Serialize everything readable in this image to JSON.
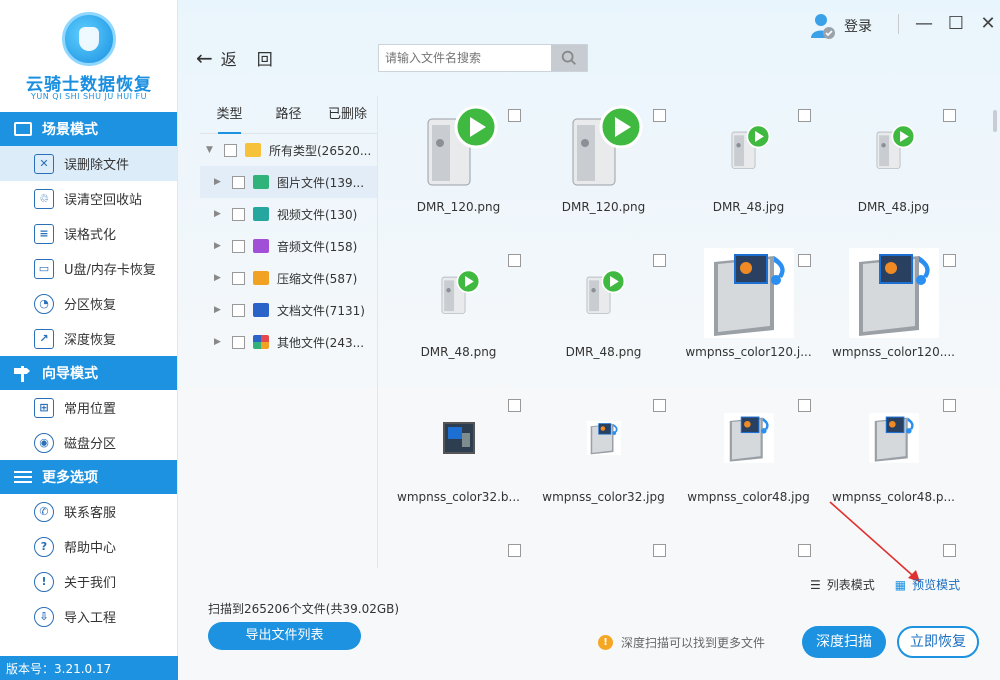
{
  "logo": {
    "title": "云骑士数据恢复",
    "subtitle": "YUN QI SHI SHU JU HUI FU"
  },
  "sidebar": {
    "sections": [
      {
        "title": "场景模式",
        "icon": "scene-icon",
        "items": [
          {
            "label": "误删除文件",
            "icon": "deleted-file-icon",
            "active": true
          },
          {
            "label": "误清空回收站",
            "icon": "recycle-bin-icon"
          },
          {
            "label": "误格式化",
            "icon": "format-icon"
          },
          {
            "label": "U盘/内存卡恢复",
            "icon": "usb-icon"
          },
          {
            "label": "分区恢复",
            "icon": "partition-icon"
          },
          {
            "label": "深度恢复",
            "icon": "deep-recovery-icon"
          }
        ]
      },
      {
        "title": "向导模式",
        "icon": "guide-icon",
        "items": [
          {
            "label": "常用位置",
            "icon": "location-icon"
          },
          {
            "label": "磁盘分区",
            "icon": "disk-icon"
          }
        ]
      },
      {
        "title": "更多选项",
        "icon": "menu-icon",
        "items": [
          {
            "label": "联系客服",
            "icon": "phone-icon"
          },
          {
            "label": "帮助中心",
            "icon": "help-icon"
          },
          {
            "label": "关于我们",
            "icon": "info-icon"
          },
          {
            "label": "导入工程",
            "icon": "import-icon"
          }
        ]
      }
    ],
    "version": "版本号：3.21.0.17"
  },
  "topbar": {
    "back_label": "返　回",
    "search_placeholder": "请输入文件名搜索",
    "login_label": "登录"
  },
  "tree": {
    "tabs": [
      "类型",
      "路径",
      "已删除"
    ],
    "root": {
      "label": "所有类型(26520..."
    },
    "children": [
      {
        "label": "图片文件(139...",
        "color": "#2fb37a",
        "selected": true
      },
      {
        "label": "视频文件(130)",
        "color": "#25a7a0"
      },
      {
        "label": "音频文件(158)",
        "color": "#a14fd6"
      },
      {
        "label": "压缩文件(587)",
        "color": "#f2a223"
      },
      {
        "label": "文档文件(7131)",
        "color": "#2b64c9"
      },
      {
        "label": "其他文件(243...",
        "color": "#e5484d"
      }
    ]
  },
  "files": [
    {
      "name": "DMR_120.png",
      "thumb": "dmr-large"
    },
    {
      "name": "DMR_120.png",
      "thumb": "dmr-large"
    },
    {
      "name": "DMR_48.jpg",
      "thumb": "dmr-small"
    },
    {
      "name": "DMR_48.jpg",
      "thumb": "dmr-small"
    },
    {
      "name": "DMR_48.png",
      "thumb": "dmr-small"
    },
    {
      "name": "DMR_48.png",
      "thumb": "dmr-small"
    },
    {
      "name": "wmpnss_color120.j...",
      "thumb": "wmp-large"
    },
    {
      "name": "wmpnss_color120....",
      "thumb": "wmp-large"
    },
    {
      "name": "wmpnss_color32.b...",
      "thumb": "wmp-bmp"
    },
    {
      "name": "wmpnss_color32.jpg",
      "thumb": "wmp-tiny"
    },
    {
      "name": "wmpnss_color48.jpg",
      "thumb": "wmp-small"
    },
    {
      "name": "wmpnss_color48.p...",
      "thumb": "wmp-small"
    },
    {
      "name": "",
      "thumb": "partial-gray"
    },
    {
      "name": "",
      "thumb": "partial-screen"
    },
    {
      "name": "",
      "thumb": "partial-dark"
    },
    {
      "name": "",
      "thumb": "partial-dark"
    }
  ],
  "view": {
    "list_label": "列表模式",
    "preview_label": "预览模式",
    "active": "preview"
  },
  "status": {
    "scan_text": "扫描到265206个文件(共39.02GB)"
  },
  "buttons": {
    "export": "导出文件列表",
    "deep_scan": "深度扫描",
    "recover": "立即恢复"
  },
  "hint": {
    "text": "深度扫描可以找到更多文件"
  },
  "colors": {
    "accent": "#1c92e0",
    "warning": "#f5a623"
  }
}
